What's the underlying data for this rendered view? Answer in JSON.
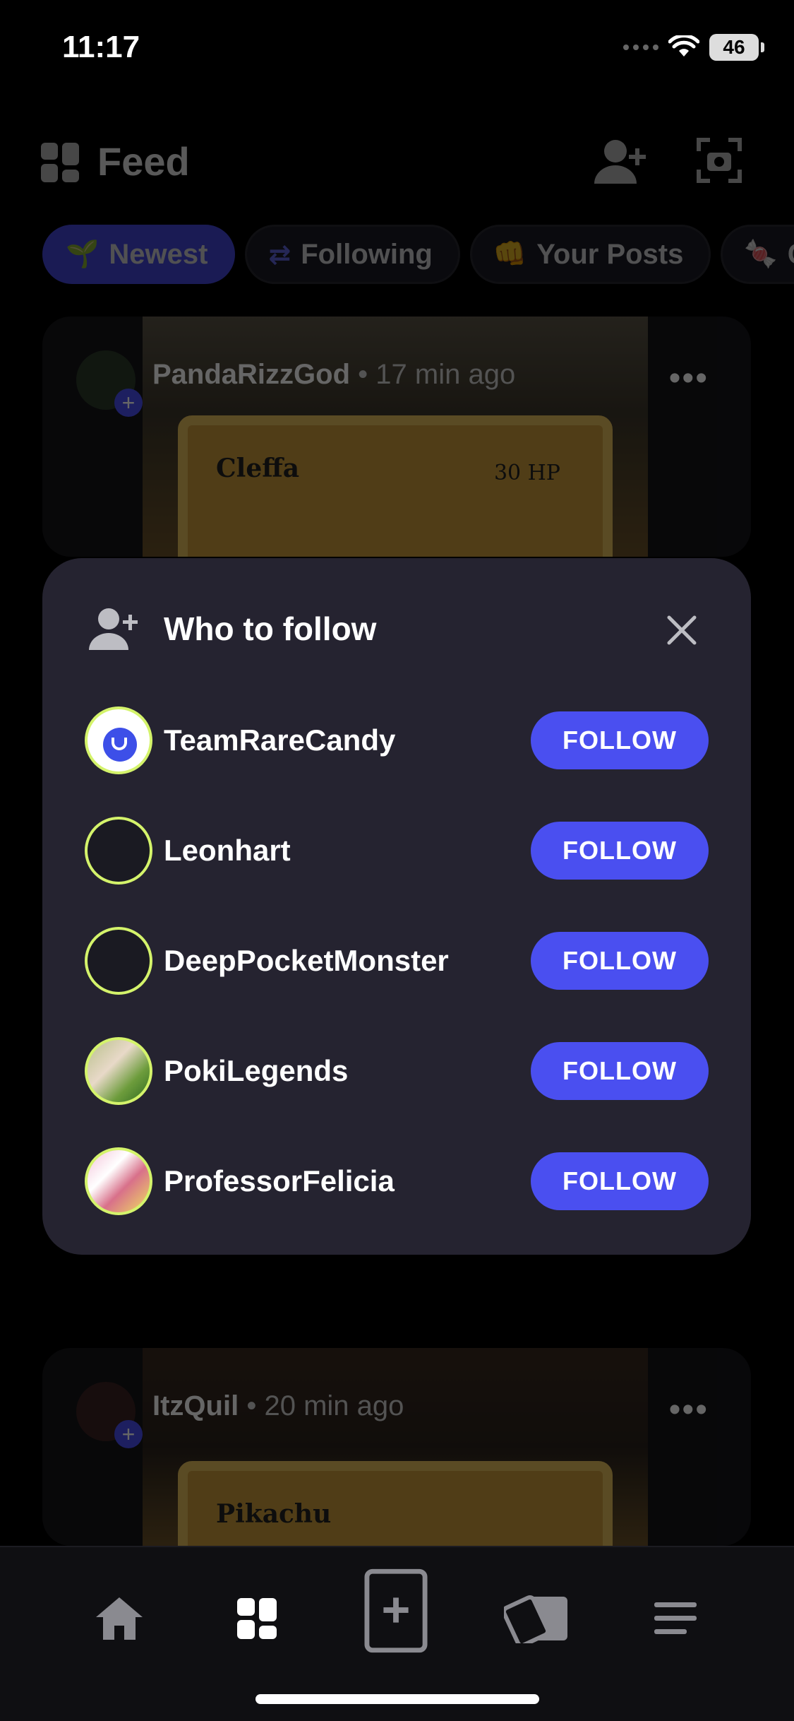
{
  "status_bar": {
    "time": "11:17",
    "battery": "46"
  },
  "header": {
    "title": "Feed",
    "icons": [
      "grid-icon",
      "add-user-icon",
      "scan-icon"
    ]
  },
  "filters": [
    {
      "label": "Newest",
      "icon": "sprout-icon",
      "active": true
    },
    {
      "label": "Following",
      "icon": "swap-icon",
      "active": false
    },
    {
      "label": "Your Posts",
      "icon": "fist-icon",
      "active": false
    },
    {
      "label": "Ca",
      "icon": "candy-icon",
      "active": false
    }
  ],
  "posts": [
    {
      "username": "PandaRizzGod",
      "time_ago": "17 min ago",
      "card_name": "Cleffa",
      "card_hp": "30 HP"
    },
    {
      "username": "ItzQuil",
      "time_ago": "20 min ago",
      "card_name": "Pikachu"
    }
  ],
  "modal": {
    "title": "Who to follow",
    "button_label": "FOLLOW",
    "users": [
      {
        "name": "TeamRareCandy"
      },
      {
        "name": "Leonhart"
      },
      {
        "name": "DeepPocketMonster"
      },
      {
        "name": "PokiLegends"
      },
      {
        "name": "ProfessorFelicia"
      }
    ]
  },
  "colors": {
    "accent": "#4a4ff0",
    "avatar_ring": "#d4f36b",
    "modal_bg": "#252330"
  },
  "bottom_nav": [
    "home-icon",
    "feed-icon",
    "add-card-icon",
    "cards-icon",
    "menu-icon"
  ]
}
